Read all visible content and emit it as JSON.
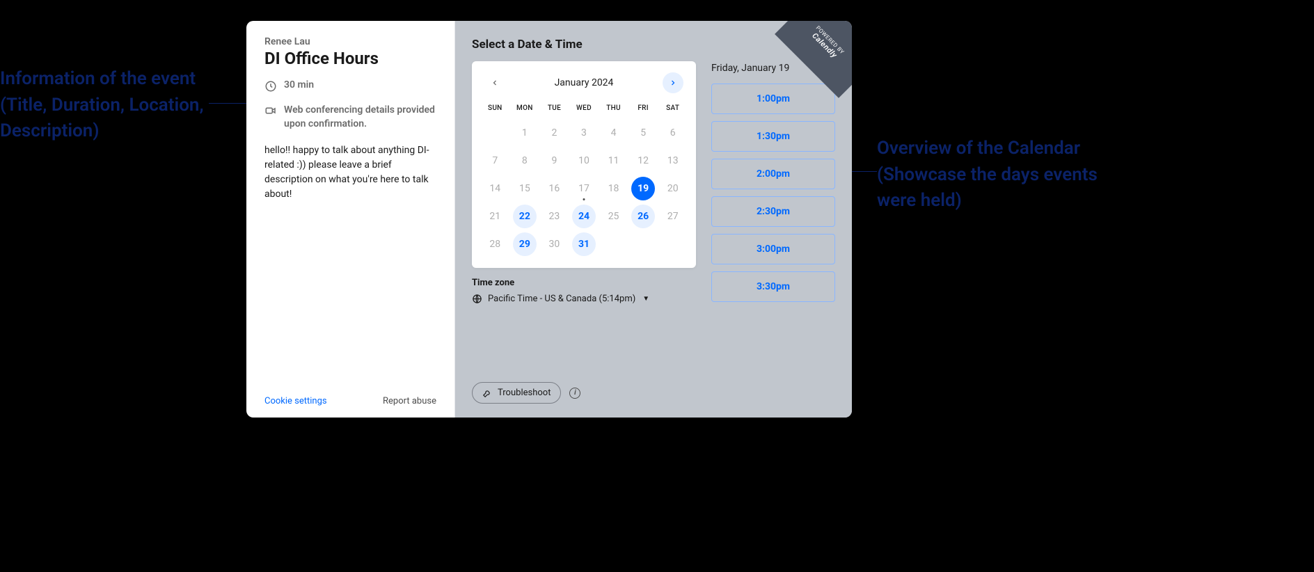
{
  "annotations": {
    "left": "Information of the event (Title, Duration, Location, Description)",
    "right": "Overview of the Calendar (Showcase the days events were held)"
  },
  "badge": {
    "powered": "POWERED BY",
    "brand": "Calendly"
  },
  "event": {
    "host": "Renee Lau",
    "title": "DI Office Hours",
    "duration": "30 min",
    "location": "Web conferencing details provided upon confirmation.",
    "description": "hello!! happy to talk about anything DI-related :)) please leave a brief description on what you're here to talk about!"
  },
  "links": {
    "cookie": "Cookie settings",
    "report": "Report abuse"
  },
  "heading": "Select a Date & Time",
  "calendar": {
    "month": "January 2024",
    "dow": [
      "SUN",
      "MON",
      "TUE",
      "WED",
      "THU",
      "FRI",
      "SAT"
    ],
    "weeks": [
      [
        {
          "n": "",
          "state": ""
        },
        {
          "n": "1",
          "state": "muted"
        },
        {
          "n": "2",
          "state": "muted"
        },
        {
          "n": "3",
          "state": "muted"
        },
        {
          "n": "4",
          "state": "muted"
        },
        {
          "n": "5",
          "state": "muted"
        },
        {
          "n": "6",
          "state": "muted"
        }
      ],
      [
        {
          "n": "7",
          "state": "muted"
        },
        {
          "n": "8",
          "state": "muted"
        },
        {
          "n": "9",
          "state": "muted"
        },
        {
          "n": "10",
          "state": "muted"
        },
        {
          "n": "11",
          "state": "muted"
        },
        {
          "n": "12",
          "state": "muted"
        },
        {
          "n": "13",
          "state": "muted"
        }
      ],
      [
        {
          "n": "14",
          "state": "muted"
        },
        {
          "n": "15",
          "state": "muted"
        },
        {
          "n": "16",
          "state": "muted"
        },
        {
          "n": "17",
          "state": "muted",
          "today": true
        },
        {
          "n": "18",
          "state": "muted"
        },
        {
          "n": "19",
          "state": "selected"
        },
        {
          "n": "20",
          "state": "muted"
        }
      ],
      [
        {
          "n": "21",
          "state": "muted"
        },
        {
          "n": "22",
          "state": "avail"
        },
        {
          "n": "23",
          "state": "muted"
        },
        {
          "n": "24",
          "state": "avail"
        },
        {
          "n": "25",
          "state": "muted"
        },
        {
          "n": "26",
          "state": "avail"
        },
        {
          "n": "27",
          "state": "muted"
        }
      ],
      [
        {
          "n": "28",
          "state": "muted"
        },
        {
          "n": "29",
          "state": "avail"
        },
        {
          "n": "30",
          "state": "muted"
        },
        {
          "n": "31",
          "state": "avail"
        },
        {
          "n": "",
          "state": ""
        },
        {
          "n": "",
          "state": ""
        },
        {
          "n": "",
          "state": ""
        }
      ]
    ]
  },
  "timezone": {
    "label": "Time zone",
    "value": "Pacific Time - US & Canada (5:14pm)"
  },
  "slots": {
    "date": "Friday, January 19",
    "times": [
      "1:00pm",
      "1:30pm",
      "2:00pm",
      "2:30pm",
      "3:00pm",
      "3:30pm"
    ]
  },
  "footer": {
    "troubleshoot": "Troubleshoot"
  }
}
